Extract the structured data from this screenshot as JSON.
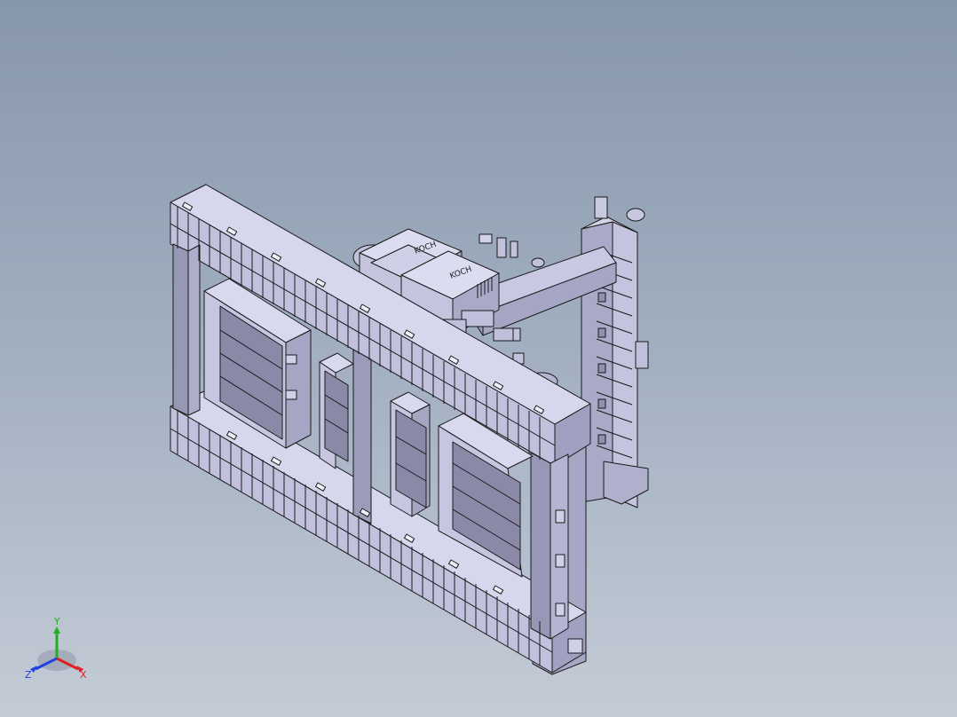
{
  "viewport": {
    "model_description_visible": false,
    "background_top": "#8797aa",
    "background_bottom": "#c4cbd6",
    "model_face_color": "#b9b9d6",
    "model_face_dark": "#9a9ab8",
    "model_edge_color": "#1a1a1a"
  },
  "parts": {
    "display_units": [
      {
        "brand": "KOCH"
      },
      {
        "brand": "KOCH"
      }
    ]
  },
  "triad": {
    "x_label": "X",
    "y_label": "Y",
    "z_label": "Z",
    "x_color": "#e02020",
    "y_color": "#20b020",
    "z_color": "#2040e0"
  }
}
